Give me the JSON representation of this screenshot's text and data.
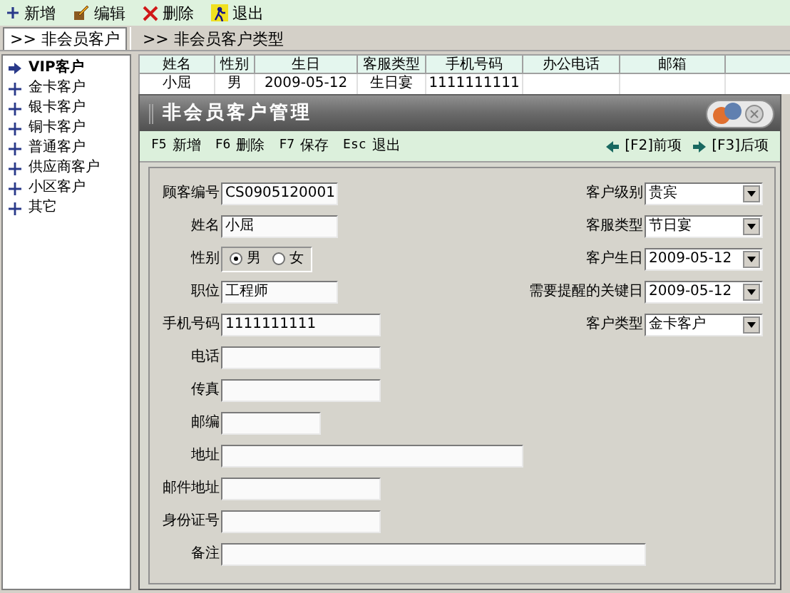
{
  "toolbar": [
    {
      "kind": "add",
      "label": "新增"
    },
    {
      "kind": "edit",
      "label": "编辑"
    },
    {
      "kind": "delete",
      "label": "删除"
    },
    {
      "kind": "exit",
      "label": "退出"
    }
  ],
  "tabs": [
    {
      "label": ">> 非会员客户",
      "selected": true
    },
    {
      "label": ">> 非会员客户类型",
      "selected": false
    }
  ],
  "sidebar": {
    "items": [
      {
        "label": "VIP客户",
        "selected": true
      },
      {
        "label": "金卡客户",
        "selected": false
      },
      {
        "label": "银卡客户",
        "selected": false
      },
      {
        "label": "铜卡客户",
        "selected": false
      },
      {
        "label": "普通客户",
        "selected": false
      },
      {
        "label": "供应商客户",
        "selected": false
      },
      {
        "label": "小区客户",
        "selected": false
      },
      {
        "label": "其它",
        "selected": false
      }
    ]
  },
  "table": {
    "columns": [
      "姓名",
      "性别",
      "生日",
      "客服类型",
      "手机号码",
      "办公电话",
      "邮箱"
    ],
    "rows": [
      [
        "小屈",
        "男",
        "2009-05-12",
        "生日宴",
        "1111111111",
        "",
        ""
      ]
    ]
  },
  "dialog": {
    "title": "非会员客户管理",
    "commands": [
      {
        "key": "F5",
        "label": "新增"
      },
      {
        "key": "F6",
        "label": "删除"
      },
      {
        "key": "F7",
        "label": "保存"
      },
      {
        "key": "Esc",
        "label": "退出"
      }
    ],
    "nav": [
      {
        "label": "[F2]前项"
      },
      {
        "label": "[F3]后项"
      }
    ],
    "left_fields": [
      {
        "kind": "text",
        "label": "顾客编号",
        "value": "CS0905120001"
      },
      {
        "kind": "text",
        "label": "姓名",
        "value": "小屈"
      },
      {
        "kind": "radio",
        "label": "性别",
        "options": [
          {
            "label": "男",
            "selected": true
          },
          {
            "label": "女",
            "selected": false
          }
        ]
      },
      {
        "kind": "text",
        "label": "职位",
        "value": "工程师"
      },
      {
        "kind": "text",
        "label": "手机号码",
        "value": "1111111111"
      },
      {
        "kind": "text",
        "label": "电话"
      },
      {
        "kind": "text",
        "label": "传真"
      },
      {
        "kind": "text",
        "label": "邮编"
      },
      {
        "kind": "text",
        "label": "地址"
      },
      {
        "kind": "text",
        "label": "邮件地址"
      },
      {
        "kind": "text",
        "label": "身份证号"
      },
      {
        "kind": "text",
        "label": "备注"
      }
    ],
    "right_fields": [
      {
        "label": "客户级别",
        "value": "贵宾"
      },
      {
        "label": "客服类型",
        "value": "节日宴"
      },
      {
        "label": "客户生日",
        "value": "2009-05-12"
      },
      {
        "label": "需要提醒的关键日",
        "value": "2009-05-12"
      },
      {
        "label": "客户类型",
        "value": "金卡客户"
      }
    ]
  }
}
